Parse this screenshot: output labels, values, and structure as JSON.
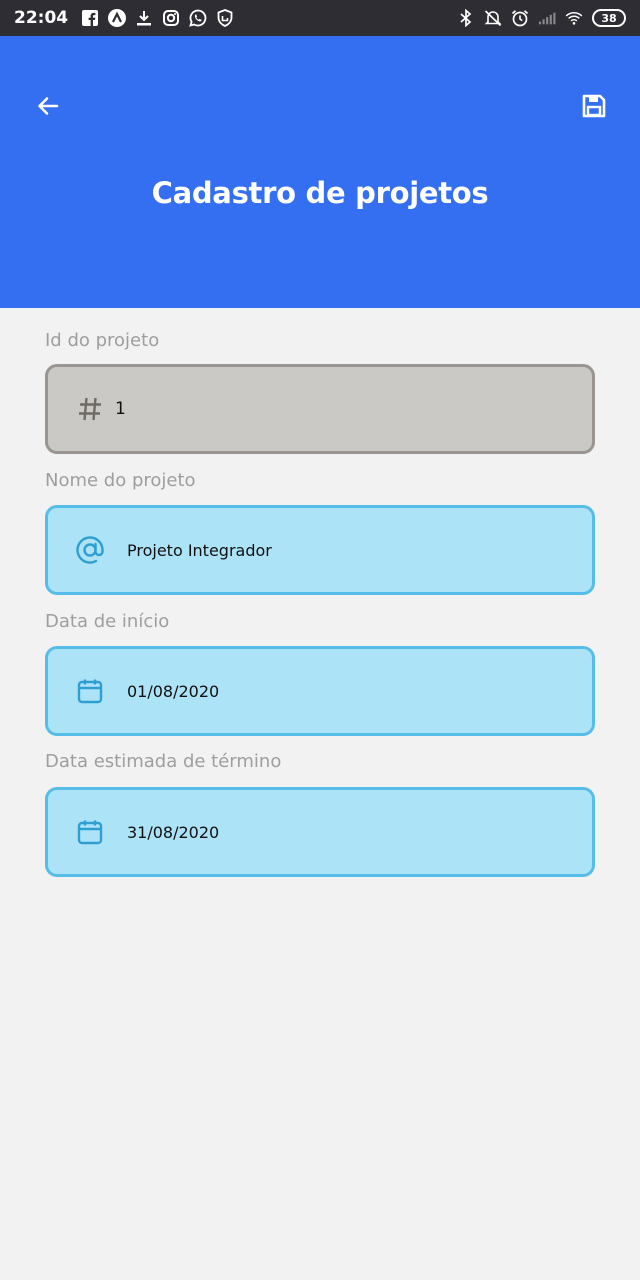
{
  "status_bar": {
    "time": "22:04",
    "battery": "38",
    "left_icons": [
      "facebook-icon",
      "notification-app-icon",
      "download-icon",
      "instagram-icon",
      "whatsapp-icon",
      "shield-icon"
    ],
    "right_icons": [
      "bluetooth-icon",
      "mute-icon",
      "alarm-icon",
      "signal-icon",
      "wifi-icon"
    ]
  },
  "header": {
    "title": "Cadastro de projetos",
    "back_icon": "arrow-left-icon",
    "save_icon": "floppy-disk-icon",
    "background": "#336ff0"
  },
  "form": {
    "id_field": {
      "label": "Id do projeto",
      "value": "1",
      "icon": "hash-icon",
      "state": "disabled"
    },
    "name_field": {
      "label": "Nome do projeto",
      "value": "Projeto Integrador",
      "icon": "at-icon"
    },
    "start_field": {
      "label": "Data de início",
      "value": "01/08/2020",
      "icon": "calendar-icon"
    },
    "end_field": {
      "label": "Data estimada de término",
      "value": "31/08/2020",
      "icon": "calendar-icon"
    }
  },
  "colors": {
    "accent": "#336ff0",
    "field_bg": "#ade3f7",
    "field_border": "#55bde8",
    "disabled_bg": "#cbc9c6",
    "disabled_border": "#9a9590"
  }
}
